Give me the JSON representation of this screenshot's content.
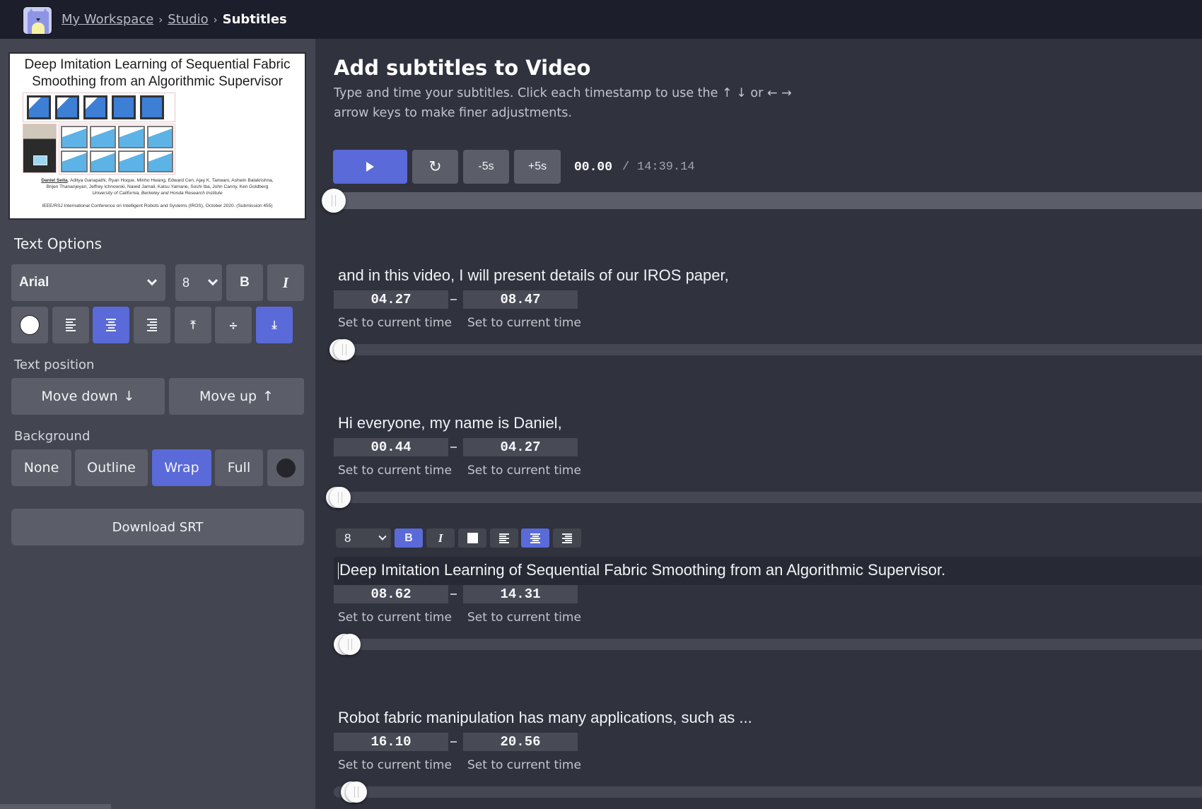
{
  "header": {
    "logo_icon": "cat-logo-icon",
    "breadcrumb": [
      {
        "label": "My Workspace",
        "link": true
      },
      {
        "label": "Studio",
        "link": true
      },
      {
        "label": "Subtitles",
        "link": false
      }
    ],
    "separator": "›"
  },
  "sidebar": {
    "thumbnail": {
      "title_line1": "Deep Imitation Learning of Sequential Fabric",
      "title_line2": "Smoothing from an Algorithmic Supervisor",
      "first_author": "Daniel Seita",
      "authors_line1_rest": ", Aditya Ganapathi, Ryan Hoque, Minho Hwang, Edward Cen, Ajay K. Tanwani, Ashwin Balakrishna,",
      "authors_line2": "Brijen Thananjeyan, Jeffrey Ichnowski, Nawid Jamali, Katsu Yamane, Soshi Iba, John Canny, Ken Goldberg",
      "institution": "University of California, Berkeley and Honda Research Institute",
      "venue": "IEEE/RSJ International Conference on Intelligent Robots and Systems (IROS), October 2020. (Submission 455)"
    },
    "text_options_heading": "Text Options",
    "font": {
      "value": "Arial"
    },
    "size": {
      "value": "8"
    },
    "bold_label": "B",
    "italic_label": "I",
    "text_color": "#ffffff",
    "alignment": {
      "options": [
        "left",
        "center",
        "right"
      ],
      "selected": "center"
    },
    "vertical": {
      "options": [
        "top",
        "middle",
        "bottom"
      ],
      "selected": "bottom"
    },
    "text_position_label": "Text position",
    "move_down_label": "Move down",
    "move_up_label": "Move up",
    "background_label": "Background",
    "background_options": [
      "None",
      "Outline",
      "Wrap",
      "Full"
    ],
    "background_selected": "Wrap",
    "background_color": "#25262b",
    "download_label": "Download SRT"
  },
  "main": {
    "title": "Add subtitles to Video",
    "description": "Type and time your subtitles. Click each timestamp to use the ↑ ↓ or ← → arrow keys to make finer adjustments.",
    "controls": {
      "play_icon": "play-icon",
      "restart_icon": "restart-icon",
      "back_label": "-5s",
      "forward_label": "+5s",
      "current_time": "00.00",
      "separator": "/",
      "total_time": "14:39.14",
      "progress": 0
    },
    "set_current_label": "Set to current time",
    "editor_toolbar": {
      "size": "8",
      "bold": "B",
      "italic": "I",
      "bold_active": true,
      "align_selected": "center"
    },
    "subtitles": [
      {
        "text": "and in this video, I will present details of our IROS paper,",
        "start": "04.27",
        "end": "08.47",
        "editing": false
      },
      {
        "text": "Hi everyone, my name is Daniel,",
        "start": "00.44",
        "end": "04.27",
        "editing": false
      },
      {
        "text": "Deep Imitation Learning of Sequential Fabric Smoothing from an Algorithmic Supervisor.",
        "start": "08.62",
        "end": "14.31",
        "editing": true
      },
      {
        "text": "Robot fabric manipulation has many applications, such as ...",
        "start": "16.10",
        "end": "20.56",
        "editing": false
      }
    ]
  },
  "colors": {
    "accent": "#5a6ad9",
    "header_bg": "#1c1f2b",
    "sidebar_bg": "#434550",
    "main_bg": "#30323e",
    "button_bg": "#5b5d68"
  }
}
